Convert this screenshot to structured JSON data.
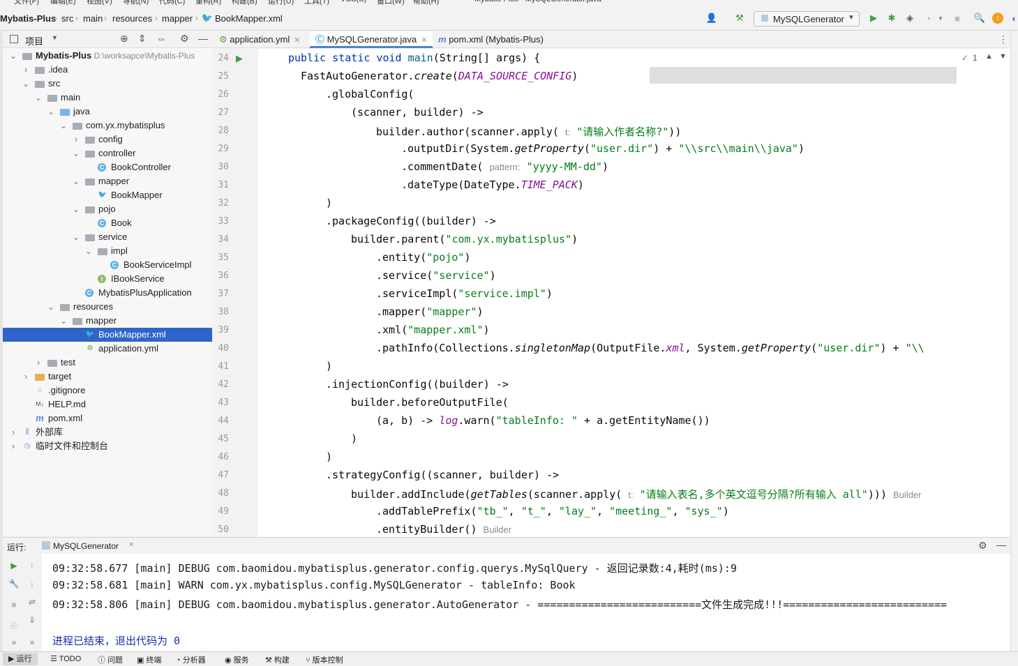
{
  "menu": [
    "文件(F)",
    "编辑(E)",
    "视图(V)",
    "导航(N)",
    "代码(C)",
    "重构(R)",
    "构建(B)",
    "运行(U)",
    "工具(T)",
    "VCS(S)",
    "窗口(W)",
    "帮助(H)",
    "Mybatis-Plus - MySQLGenerator.java"
  ],
  "breadcrumb": [
    "Mybatis-Plus",
    "src",
    "main",
    "resources",
    "mapper",
    "BookMapper.xml"
  ],
  "run_config": "MySQLGenerator",
  "project_panel": {
    "title": "项目",
    "tree": [
      {
        "label": "Mybatis-Plus",
        "path": "D:\\worksapce\\Mybatis-Plus",
        "depth": 0,
        "icon": "module-icon",
        "expanded": true
      },
      {
        "label": ".idea",
        "depth": 1,
        "icon": "folder-icon",
        "expanded": false
      },
      {
        "label": "src",
        "depth": 1,
        "icon": "folder-icon",
        "expanded": true
      },
      {
        "label": "main",
        "depth": 2,
        "icon": "folder-icon",
        "expanded": true
      },
      {
        "label": "java",
        "depth": 3,
        "icon": "source-folder-icon",
        "expanded": true
      },
      {
        "label": "com.yx.mybatisplus",
        "depth": 4,
        "icon": "package-icon",
        "expanded": true
      },
      {
        "label": "config",
        "depth": 5,
        "icon": "package-icon",
        "expanded": false
      },
      {
        "label": "controller",
        "depth": 5,
        "icon": "package-icon",
        "expanded": true
      },
      {
        "label": "BookController",
        "depth": 6,
        "icon": "class-icon"
      },
      {
        "label": "mapper",
        "depth": 5,
        "icon": "package-icon",
        "expanded": true
      },
      {
        "label": "BookMapper",
        "depth": 6,
        "icon": "mybatis-icon"
      },
      {
        "label": "pojo",
        "depth": 5,
        "icon": "package-icon",
        "expanded": true
      },
      {
        "label": "Book",
        "depth": 6,
        "icon": "class-icon"
      },
      {
        "label": "service",
        "depth": 5,
        "icon": "package-icon",
        "expanded": true
      },
      {
        "label": "impl",
        "depth": 6,
        "icon": "package-icon",
        "expanded": true
      },
      {
        "label": "BookServiceImpl",
        "depth": 7,
        "icon": "class-icon"
      },
      {
        "label": "IBookService",
        "depth": 6,
        "icon": "interface-icon"
      },
      {
        "label": "MybatisPlusApplication",
        "depth": 5,
        "icon": "spring-class-icon"
      },
      {
        "label": "resources",
        "depth": 3,
        "icon": "resources-folder-icon",
        "expanded": true
      },
      {
        "label": "mapper",
        "depth": 4,
        "icon": "folder-icon",
        "expanded": true
      },
      {
        "label": "BookMapper.xml",
        "depth": 5,
        "icon": "mybatis-xml-icon",
        "selected": true
      },
      {
        "label": "application.yml",
        "depth": 5,
        "icon": "yaml-icon"
      },
      {
        "label": "test",
        "depth": 2,
        "icon": "folder-icon",
        "expanded": false
      },
      {
        "label": "target",
        "depth": 1,
        "icon": "excluded-folder-icon",
        "expanded": false
      },
      {
        "label": ".gitignore",
        "depth": 1,
        "icon": "gitignore-icon"
      },
      {
        "label": "HELP.md",
        "depth": 1,
        "icon": "markdown-icon"
      },
      {
        "label": "pom.xml",
        "depth": 1,
        "icon": "maven-icon"
      },
      {
        "label": "外部库",
        "depth": 0,
        "icon": "library-icon",
        "expanded": false
      },
      {
        "label": "临时文件和控制台",
        "depth": 0,
        "icon": "scratch-icon",
        "expanded": false
      }
    ]
  },
  "editor_tabs": [
    {
      "label": "application.yml",
      "icon": "yaml-icon",
      "active": false
    },
    {
      "label": "MySQLGenerator.java",
      "icon": "class-icon",
      "active": true
    },
    {
      "label": "pom.xml (Mybatis-Plus)",
      "icon": "maven-icon",
      "active": false
    }
  ],
  "inspection": "1",
  "code_lines": [
    {
      "n": "24",
      "indent": 0,
      "html": "<span class='kw'>public static void</span> <span class='fn'>main</span>(String[] args) {"
    },
    {
      "n": "25",
      "indent": 1,
      "html": "FastAutoGenerator.<span class='it'>create</span>(<span class='cst'>DATA_SOURCE_CONFIG</span>)"
    },
    {
      "n": "26",
      "indent": 3,
      "html": ".globalConfig("
    },
    {
      "n": "27",
      "indent": 5,
      "html": "(scanner, builder) -&gt;"
    },
    {
      "n": "28",
      "indent": 7,
      "html": "builder.author(scanner.apply( <span class='hint'>t:</span> <span class='str'>\"请输入作者名称?\"</span>))"
    },
    {
      "n": "29",
      "indent": 9,
      "html": ".outputDir(System.<span class='it'>getProperty</span>(<span class='str'>\"user.dir\"</span>) + <span class='str'>\"\\\\src\\\\main\\\\java\"</span>)"
    },
    {
      "n": "30",
      "indent": 9,
      "html": ".commentDate( <span class='hint'>pattern:</span> <span class='str'>\"yyyy-MM-dd\"</span>)"
    },
    {
      "n": "31",
      "indent": 9,
      "html": ".dateType(DateType.<span class='cst'>TIME_PACK</span>)"
    },
    {
      "n": "32",
      "indent": 3,
      "html": ")"
    },
    {
      "n": "33",
      "indent": 3,
      "html": ".packageConfig((builder) -&gt;"
    },
    {
      "n": "34",
      "indent": 5,
      "html": "builder.parent(<span class='str'>\"com.yx.mybatisplus\"</span>)"
    },
    {
      "n": "35",
      "indent": 7,
      "html": ".entity(<span class='str'>\"pojo\"</span>)"
    },
    {
      "n": "36",
      "indent": 7,
      "html": ".service(<span class='str'>\"service\"</span>)"
    },
    {
      "n": "37",
      "indent": 7,
      "html": ".serviceImpl(<span class='str'>\"service.impl\"</span>)"
    },
    {
      "n": "38",
      "indent": 7,
      "html": ".mapper(<span class='str'>\"mapper\"</span>)"
    },
    {
      "n": "39",
      "indent": 7,
      "html": ".xml(<span class='str'>\"mapper.xml\"</span>)"
    },
    {
      "n": "40",
      "indent": 7,
      "html": ".pathInfo(Collections.<span class='it'>singletonMap</span>(OutputFile.<span class='cst'>xml</span>, System.<span class='it'>getProperty</span>(<span class='str'>\"user.dir\"</span>) + <span class='str'>\"\\\\</span>"
    },
    {
      "n": "41",
      "indent": 3,
      "html": ")"
    },
    {
      "n": "42",
      "indent": 3,
      "html": ".injectionConfig((builder) -&gt;"
    },
    {
      "n": "43",
      "indent": 5,
      "html": "builder.beforeOutputFile("
    },
    {
      "n": "44",
      "indent": 7,
      "html": "(a, b) -&gt; <span class='cst'>log</span>.warn(<span class='str'>\"tableInfo: \"</span> + a.getEntityName())"
    },
    {
      "n": "45",
      "indent": 5,
      "html": ")"
    },
    {
      "n": "46",
      "indent": 3,
      "html": ")"
    },
    {
      "n": "47",
      "indent": 3,
      "html": ".strategyConfig((scanner, builder) -&gt;"
    },
    {
      "n": "48",
      "indent": 5,
      "html": "builder.addInclude(<span class='it'>getTables</span>(scanner.apply( <span class='hint'>t:</span> <span class='str'>\"请输入表名,多个英文逗号分隔?所有输入 all\"</span>))) <span class='hint'>Builder</span>"
    },
    {
      "n": "49",
      "indent": 7,
      "html": ".addTablePrefix(<span class='str'>\"tb_\"</span>, <span class='str'>\"t_\"</span>, <span class='str'>\"lay_\"</span>, <span class='str'>\"meeting_\"</span>, <span class='str'>\"sys_\"</span>)"
    },
    {
      "n": "50",
      "indent": 7,
      "html": ".entityBuilder() <span class='hint'>Builder</span>"
    }
  ],
  "run_panel": {
    "label": "运行:",
    "tab": "MySQLGenerator",
    "output": [
      "09:32:58.677 [main] DEBUG com.baomidou.mybatisplus.generator.config.querys.MySqlQuery - 返回记录数:4,耗时(ms):9",
      "09:32:58.681 [main] WARN com.yx.mybatisplus.config.MySQLGenerator - tableInfo: Book",
      "09:32:58.806 [main] DEBUG com.baomidou.mybatisplus.generator.AutoGenerator - ==========================文件生成完成!!!=========================="
    ],
    "exit": "进程已结束，退出代码为 0"
  },
  "status_bar": [
    "运行",
    "TODO",
    "问题",
    "终端",
    "分析器",
    "服务",
    "构建",
    "版本控制"
  ]
}
